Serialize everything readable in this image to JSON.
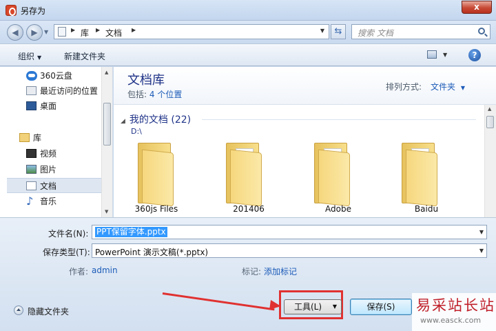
{
  "window": {
    "title": "另存为",
    "close_label": "x"
  },
  "nav": {
    "back_label": "◀",
    "forward_label": "▶",
    "breadcrumb": [
      "库",
      "文档"
    ],
    "search_placeholder": "搜索 文档"
  },
  "toolbar": {
    "organize": "组织",
    "new_folder": "新建文件夹",
    "help": "?"
  },
  "sidebar": {
    "items": [
      {
        "label": "360云盘",
        "icon": "cloud-icon"
      },
      {
        "label": "最近访问的位置",
        "icon": "recent-places-icon"
      },
      {
        "label": "桌面",
        "icon": "desktop-icon"
      },
      {
        "label": "库",
        "icon": "library-icon"
      },
      {
        "label": "视频",
        "icon": "video-icon"
      },
      {
        "label": "图片",
        "icon": "pictures-icon"
      },
      {
        "label": "文档",
        "icon": "documents-icon",
        "selected": true
      },
      {
        "label": "音乐",
        "icon": "music-icon"
      }
    ]
  },
  "library": {
    "title": "文档库",
    "includes_label": "包括:",
    "includes_link": "4 个位置",
    "arrange_label": "排列方式:",
    "arrange_value": "文件夹"
  },
  "group": {
    "header": "我的文档 (22)",
    "path": "D:\\"
  },
  "folders": [
    "360js Files",
    "201406",
    "Adobe",
    "Baidu"
  ],
  "form": {
    "filename_label": "文件名(N):",
    "filename_value": "PPT保留字体.pptx",
    "filetype_label": "保存类型(T):",
    "filetype_value": "PowerPoint 演示文稿(*.pptx)",
    "author_label": "作者:",
    "author_value": "admin",
    "tags_label": "标记:",
    "tags_value": "添加标记",
    "hide_folders": "隐藏文件夹",
    "tools_label": "工具(L)",
    "save_label": "保存(S)"
  },
  "watermark": {
    "main": "易采站长站",
    "url": "www.easck.com"
  },
  "colors": {
    "highlight": "#e03130",
    "link": "#1c5bb8",
    "title_blue": "#1e3287"
  }
}
